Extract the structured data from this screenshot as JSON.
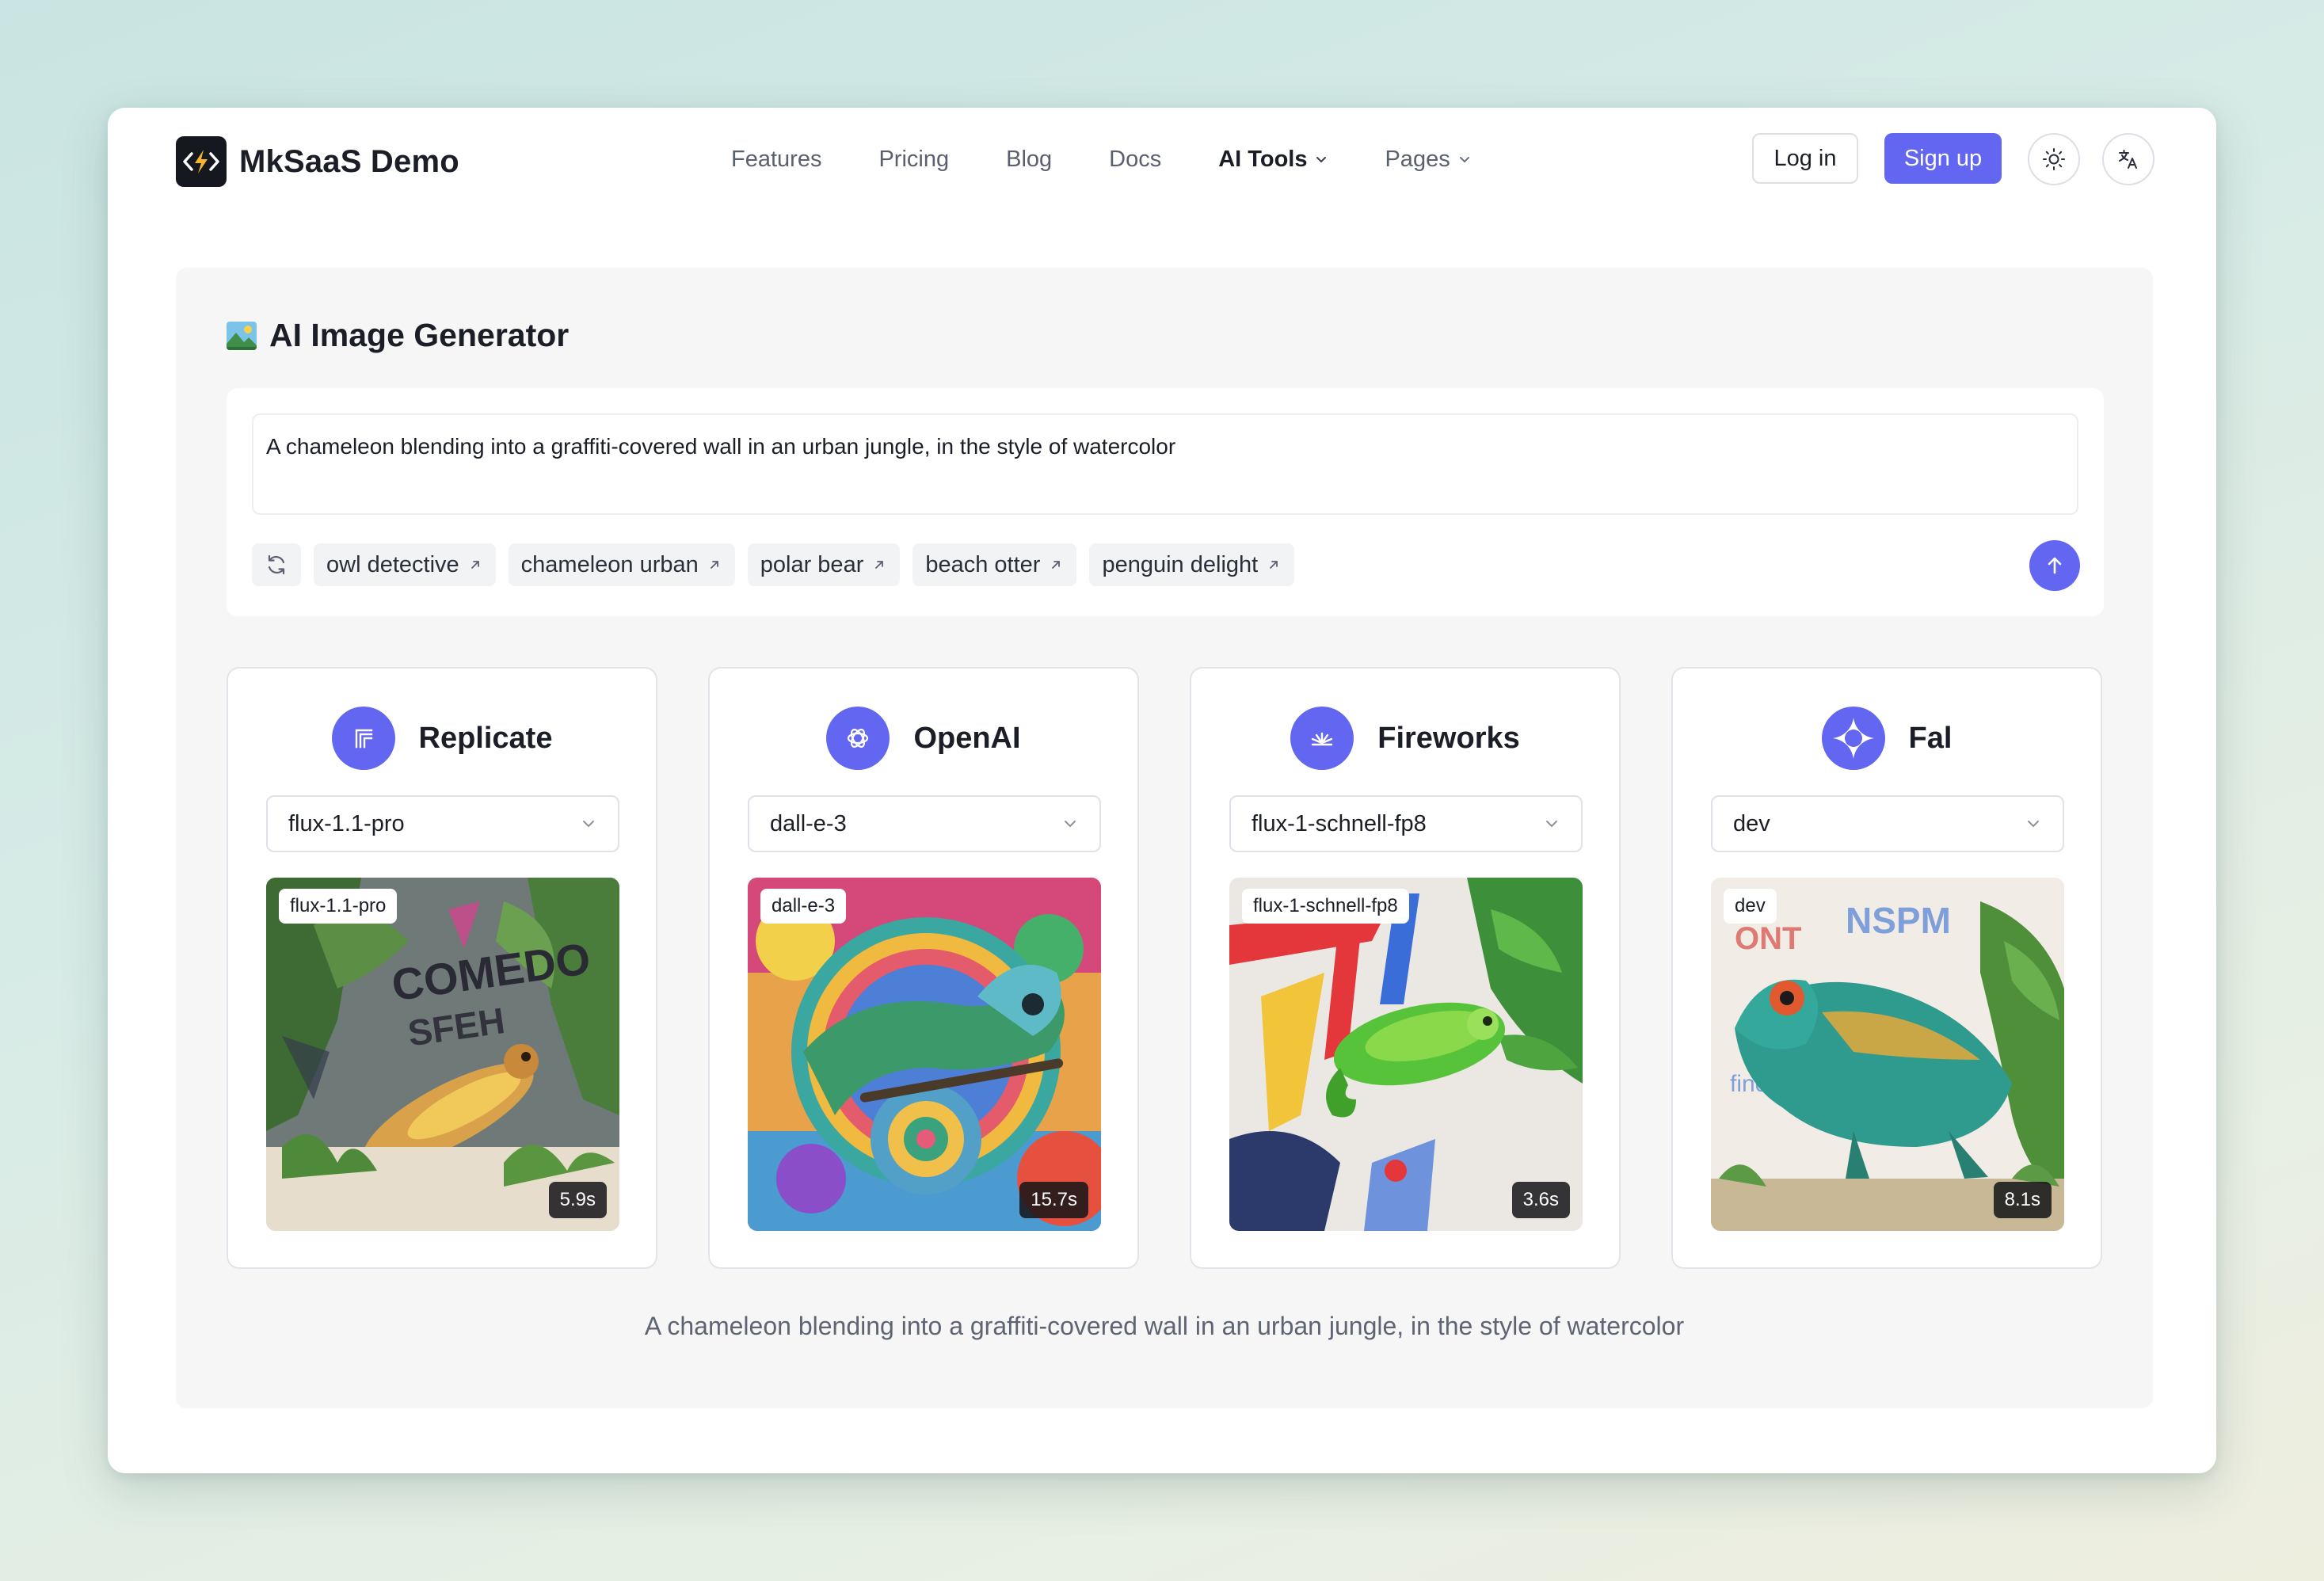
{
  "brand": {
    "name": "MkSaaS Demo",
    "logo_icon": "code-bolt-icon"
  },
  "nav": {
    "items": [
      {
        "label": "Features"
      },
      {
        "label": "Pricing"
      },
      {
        "label": "Blog"
      },
      {
        "label": "Docs"
      },
      {
        "label": "AI Tools",
        "has_dropdown": true,
        "active": true
      },
      {
        "label": "Pages",
        "has_dropdown": true
      }
    ],
    "login_label": "Log in",
    "signup_label": "Sign up",
    "theme_icon": "sun-icon",
    "language_icon": "translate-icon"
  },
  "generator": {
    "title": "AI Image Generator",
    "title_icon": "picture-emoji-icon",
    "prompt": "A chameleon blending into a graffiti-covered wall in an urban jungle, in the style of watercolor",
    "suggestions": [
      {
        "label": "owl detective"
      },
      {
        "label": "chameleon urban"
      },
      {
        "label": "polar bear"
      },
      {
        "label": "beach otter"
      },
      {
        "label": "penguin delight"
      }
    ],
    "refresh_icon": "refresh-icon",
    "send_icon": "arrow-up-icon",
    "caption": "A chameleon blending into a graffiti-covered wall in an urban jungle, in the style of watercolor"
  },
  "providers": [
    {
      "name": "Replicate",
      "icon": "replicate-icon",
      "model": "flux-1.1-pro",
      "time": "5.9s"
    },
    {
      "name": "OpenAI",
      "icon": "openai-icon",
      "model": "dall-e-3",
      "time": "15.7s"
    },
    {
      "name": "Fireworks",
      "icon": "fireworks-icon",
      "model": "flux-1-schnell-fp8",
      "time": "3.6s"
    },
    {
      "name": "Fal",
      "icon": "fal-icon",
      "model": "dev",
      "time": "8.1s"
    }
  ],
  "colors": {
    "accent": "#6366f1",
    "panel": "#f6f6f7",
    "text": "#1b1e27",
    "muted": "#5b6070"
  }
}
